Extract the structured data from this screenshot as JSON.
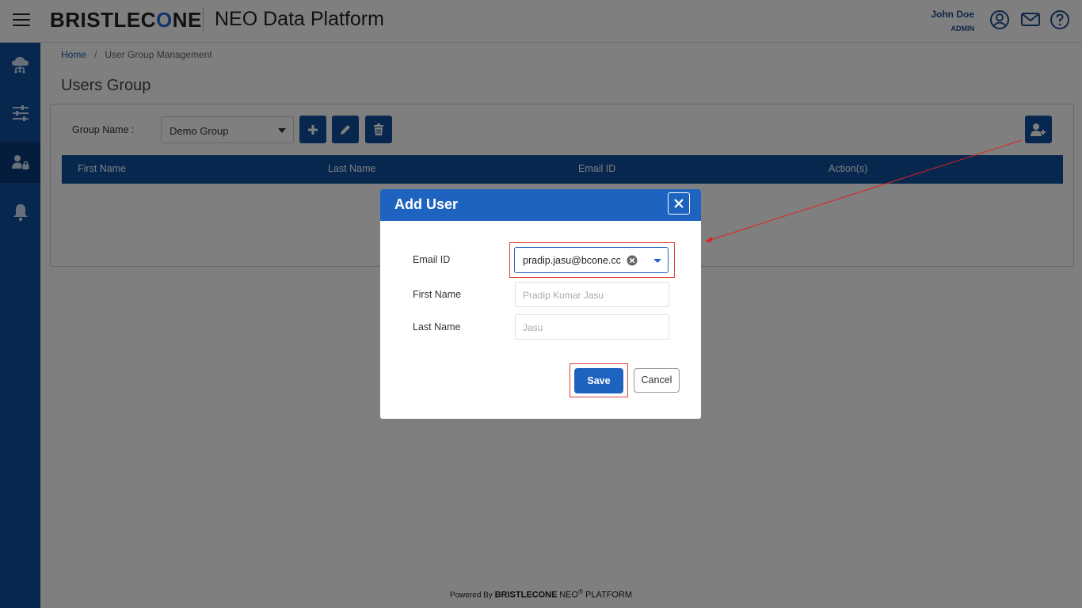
{
  "header": {
    "brand_left": "BRISTLEC",
    "brand_ring": "O",
    "brand_right": "NE",
    "app_title": "NEO Data Platform",
    "user_name": "John Doe",
    "user_role": "ADMIN",
    "icons": [
      "menu-icon",
      "profile-icon",
      "mail-icon",
      "help-icon"
    ]
  },
  "sidebar": {
    "items": [
      {
        "icon": "cloud-network-icon",
        "active": false
      },
      {
        "icon": "filter-sliders-icon",
        "active": false
      },
      {
        "icon": "user-lock-icon",
        "active": true
      },
      {
        "icon": "bell-icon",
        "active": false
      }
    ]
  },
  "breadcrumb": {
    "home": "Home",
    "separator": "/",
    "current": "User Group Management"
  },
  "page": {
    "title": "Users Group"
  },
  "group": {
    "label": "Group Name :",
    "selected": "Demo Group"
  },
  "table": {
    "columns": [
      "First Name",
      "Last Name",
      "Email ID",
      "Action(s)"
    ]
  },
  "modal": {
    "title": "Add User",
    "email_label": "Email ID",
    "email_value": "pradip.jasu@bcone.cc",
    "first_name_label": "First Name",
    "first_name_placeholder": "Pradip Kumar Jasu",
    "last_name_label": "Last Name",
    "last_name_placeholder": "Jasu",
    "save_label": "Save",
    "cancel_label": "Cancel"
  },
  "footer": {
    "powered_by": "Powered By",
    "brand": "BRISTLECONE",
    "neo": "NEO",
    "registered": "®",
    "platform": "PLATFORM"
  },
  "colors": {
    "primary": "#0f4f9f",
    "modal_header": "#1e63c0",
    "highlight": "#e04040"
  }
}
